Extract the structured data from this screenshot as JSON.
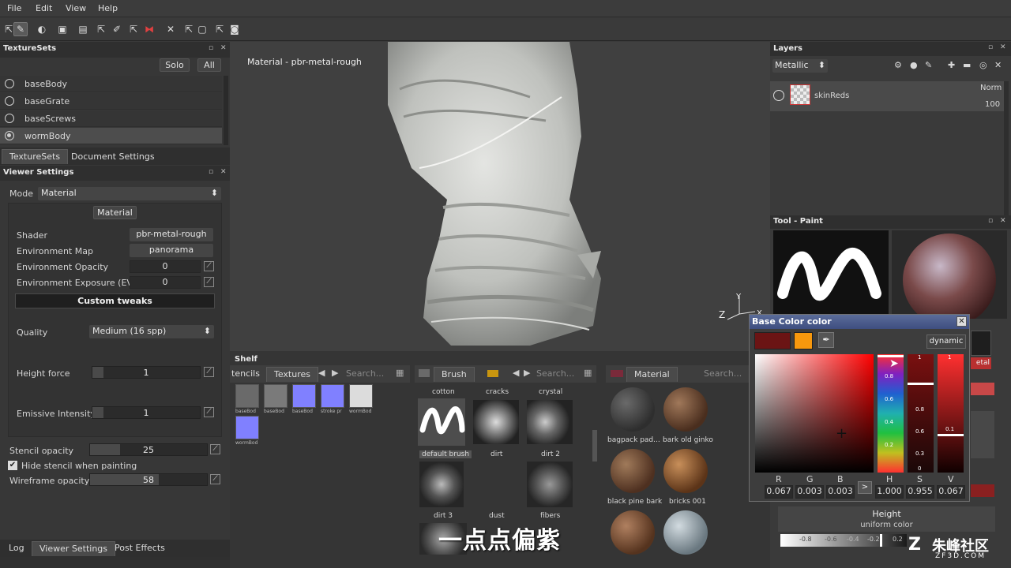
{
  "menu": [
    "File",
    "Edit",
    "View",
    "Help"
  ],
  "texture_sets": {
    "title": "TextureSets",
    "solo": "Solo",
    "all": "All",
    "items": [
      "baseBody",
      "baseGrate",
      "baseScrews",
      "wormBody"
    ],
    "selected": "wormBody",
    "tabs": [
      "TextureSets",
      "Document Settings"
    ]
  },
  "viewer_settings": {
    "title": "Viewer Settings",
    "mode_label": "Mode",
    "mode_value": "Material",
    "material_btn": "Material",
    "shader_label": "Shader",
    "shader_value": "pbr-metal-rough",
    "envmap_label": "Environment Map",
    "envmap_value": "panorama",
    "env_opacity_label": "Environment Opacity",
    "env_opacity_value": "0",
    "env_exposure_label": "Environment Exposure (EV)",
    "env_exposure_value": "0",
    "custom_tweaks": "Custom tweaks",
    "quality_label": "Quality",
    "quality_value": "Medium (16 spp)",
    "height_force_label": "Height force",
    "height_force_value": "1",
    "emissive_label": "Emissive Intensity",
    "emissive_value": "1",
    "stencil_opacity_label": "Stencil opacity",
    "stencil_opacity_value": "25",
    "hide_stencil_label": "Hide stencil when painting",
    "hide_stencil_checked": true,
    "wireframe_label": "Wireframe opacity",
    "wireframe_value": "58"
  },
  "bottom_tabs": [
    "Log",
    "Viewer Settings",
    "Post Effects"
  ],
  "viewport": {
    "label": "Material - pbr-metal-rough"
  },
  "shelf": {
    "title": "Shelf",
    "stencils_tab": "tencils",
    "textures_tab": "Textures",
    "search_placeholder": "Search...",
    "texture_thumbs": [
      "baseBod",
      "baseBod",
      "baseBod",
      "stroke pr",
      "wormBod",
      "wormBod"
    ],
    "brush_tab": "Brush",
    "brushes": [
      "cotton",
      "cracks",
      "crystal",
      "default brush",
      "dirt",
      "dirt 2",
      "dirt 3",
      "dust",
      "fibers"
    ],
    "material_tab": "Material",
    "materials": [
      "bagpack pad...",
      "bark old ginko",
      "black pine bark",
      "bricks 001"
    ]
  },
  "layers": {
    "title": "Layers",
    "channel": "Metallic",
    "layer_name": "skinReds",
    "blend": "Norm",
    "opacity": "100"
  },
  "tool_paint": {
    "title": "Tool - Paint"
  },
  "color_dialog": {
    "title": "Base Color color",
    "dynamic": "dynamic",
    "labels": [
      "R",
      "G",
      "B",
      "H",
      "S",
      "V"
    ],
    "values": [
      "0.067",
      "0.003",
      "0.003",
      "1.000",
      "0.955",
      "0.067"
    ],
    "arrow": ">",
    "h_ticks": [
      "0.8",
      "0.6",
      "0.4",
      "0.2"
    ],
    "s_ticks": [
      "1",
      "0.8",
      "0.6",
      "0.3",
      "0"
    ],
    "v_ticks": [
      "1",
      "0.1"
    ]
  },
  "height_panel": {
    "title": "Height",
    "subtitle": "uniform color",
    "ticks": [
      "-0.8",
      "-0.6",
      "-0.4",
      "-0.2",
      "0.2"
    ],
    "metal": "etal"
  },
  "caption": "一点点偏紫",
  "watermark": "朱峰社区",
  "watermark_sub": "ZF3D.COM",
  "colors": {
    "base_color": "#6b1414",
    "swatch_orange": "#f7980d",
    "selection": "#5b6c9a"
  }
}
